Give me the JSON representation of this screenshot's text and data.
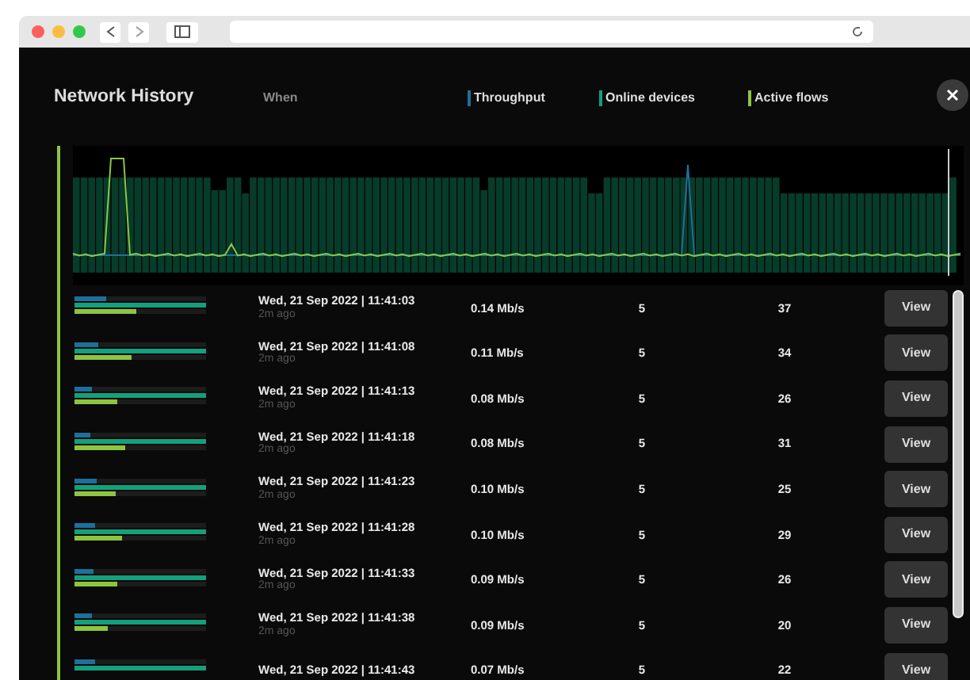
{
  "window": {
    "title": "Network History"
  },
  "columns": {
    "when": "When",
    "legend": [
      {
        "label": "Throughput",
        "color": "#1f6f9a"
      },
      {
        "label": "Online devices",
        "color": "#14a07c"
      },
      {
        "label": "Active flows",
        "color": "#8cc63f"
      }
    ]
  },
  "rows": [
    {
      "when": "Wed, 21 Sep 2022 | 11:41:03",
      "ago": "2m ago",
      "throughput": "0.14 Mb/s",
      "devices": "5",
      "flows": "37",
      "action": "View",
      "bars": [
        {
          "level": 0.24
        },
        {
          "level": 0.47
        }
      ]
    },
    {
      "when": "Wed, 21 Sep 2022 | 11:41:08",
      "ago": "2m ago",
      "throughput": "0.11 Mb/s",
      "devices": "5",
      "flows": "34",
      "action": "View",
      "bars": [
        {
          "level": 0.18
        },
        {
          "level": 0.43
        }
      ]
    },
    {
      "when": "Wed, 21 Sep 2022 | 11:41:13",
      "ago": "2m ago",
      "throughput": "0.08 Mb/s",
      "devices": "5",
      "flows": "26",
      "action": "View",
      "bars": [
        {
          "level": 0.13
        },
        {
          "level": 0.33
        }
      ]
    },
    {
      "when": "Wed, 21 Sep 2022 | 11:41:18",
      "ago": "2m ago",
      "throughput": "0.08 Mb/s",
      "devices": "5",
      "flows": "31",
      "action": "View",
      "bars": [
        {
          "level": 0.12
        },
        {
          "level": 0.39
        }
      ]
    },
    {
      "when": "Wed, 21 Sep 2022 | 11:41:23",
      "ago": "2m ago",
      "throughput": "0.10 Mb/s",
      "devices": "5",
      "flows": "25",
      "action": "View",
      "bars": [
        {
          "level": 0.17
        },
        {
          "level": 0.31
        }
      ]
    },
    {
      "when": "Wed, 21 Sep 2022 | 11:41:28",
      "ago": "2m ago",
      "throughput": "0.10 Mb/s",
      "devices": "5",
      "flows": "29",
      "action": "View",
      "bars": [
        {
          "level": 0.16
        },
        {
          "level": 0.36
        }
      ]
    },
    {
      "when": "Wed, 21 Sep 2022 | 11:41:33",
      "ago": "2m ago",
      "throughput": "0.09 Mb/s",
      "devices": "5",
      "flows": "26",
      "action": "View",
      "bars": [
        {
          "level": 0.14
        },
        {
          "level": 0.33
        }
      ]
    },
    {
      "when": "Wed, 21 Sep 2022 | 11:41:38",
      "ago": "2m ago",
      "throughput": "0.09 Mb/s",
      "devices": "5",
      "flows": "20",
      "action": "View",
      "bars": [
        {
          "level": 0.13
        },
        {
          "level": 0.25
        }
      ]
    },
    {
      "when": "Wed, 21 Sep 2022 | 11:41:43",
      "throughput": "0.07 Mb/s",
      "devices": "5",
      "flows": "22",
      "action": "View",
      "bars": [
        {
          "level": 0.16
        }
      ]
    }
  ]
}
